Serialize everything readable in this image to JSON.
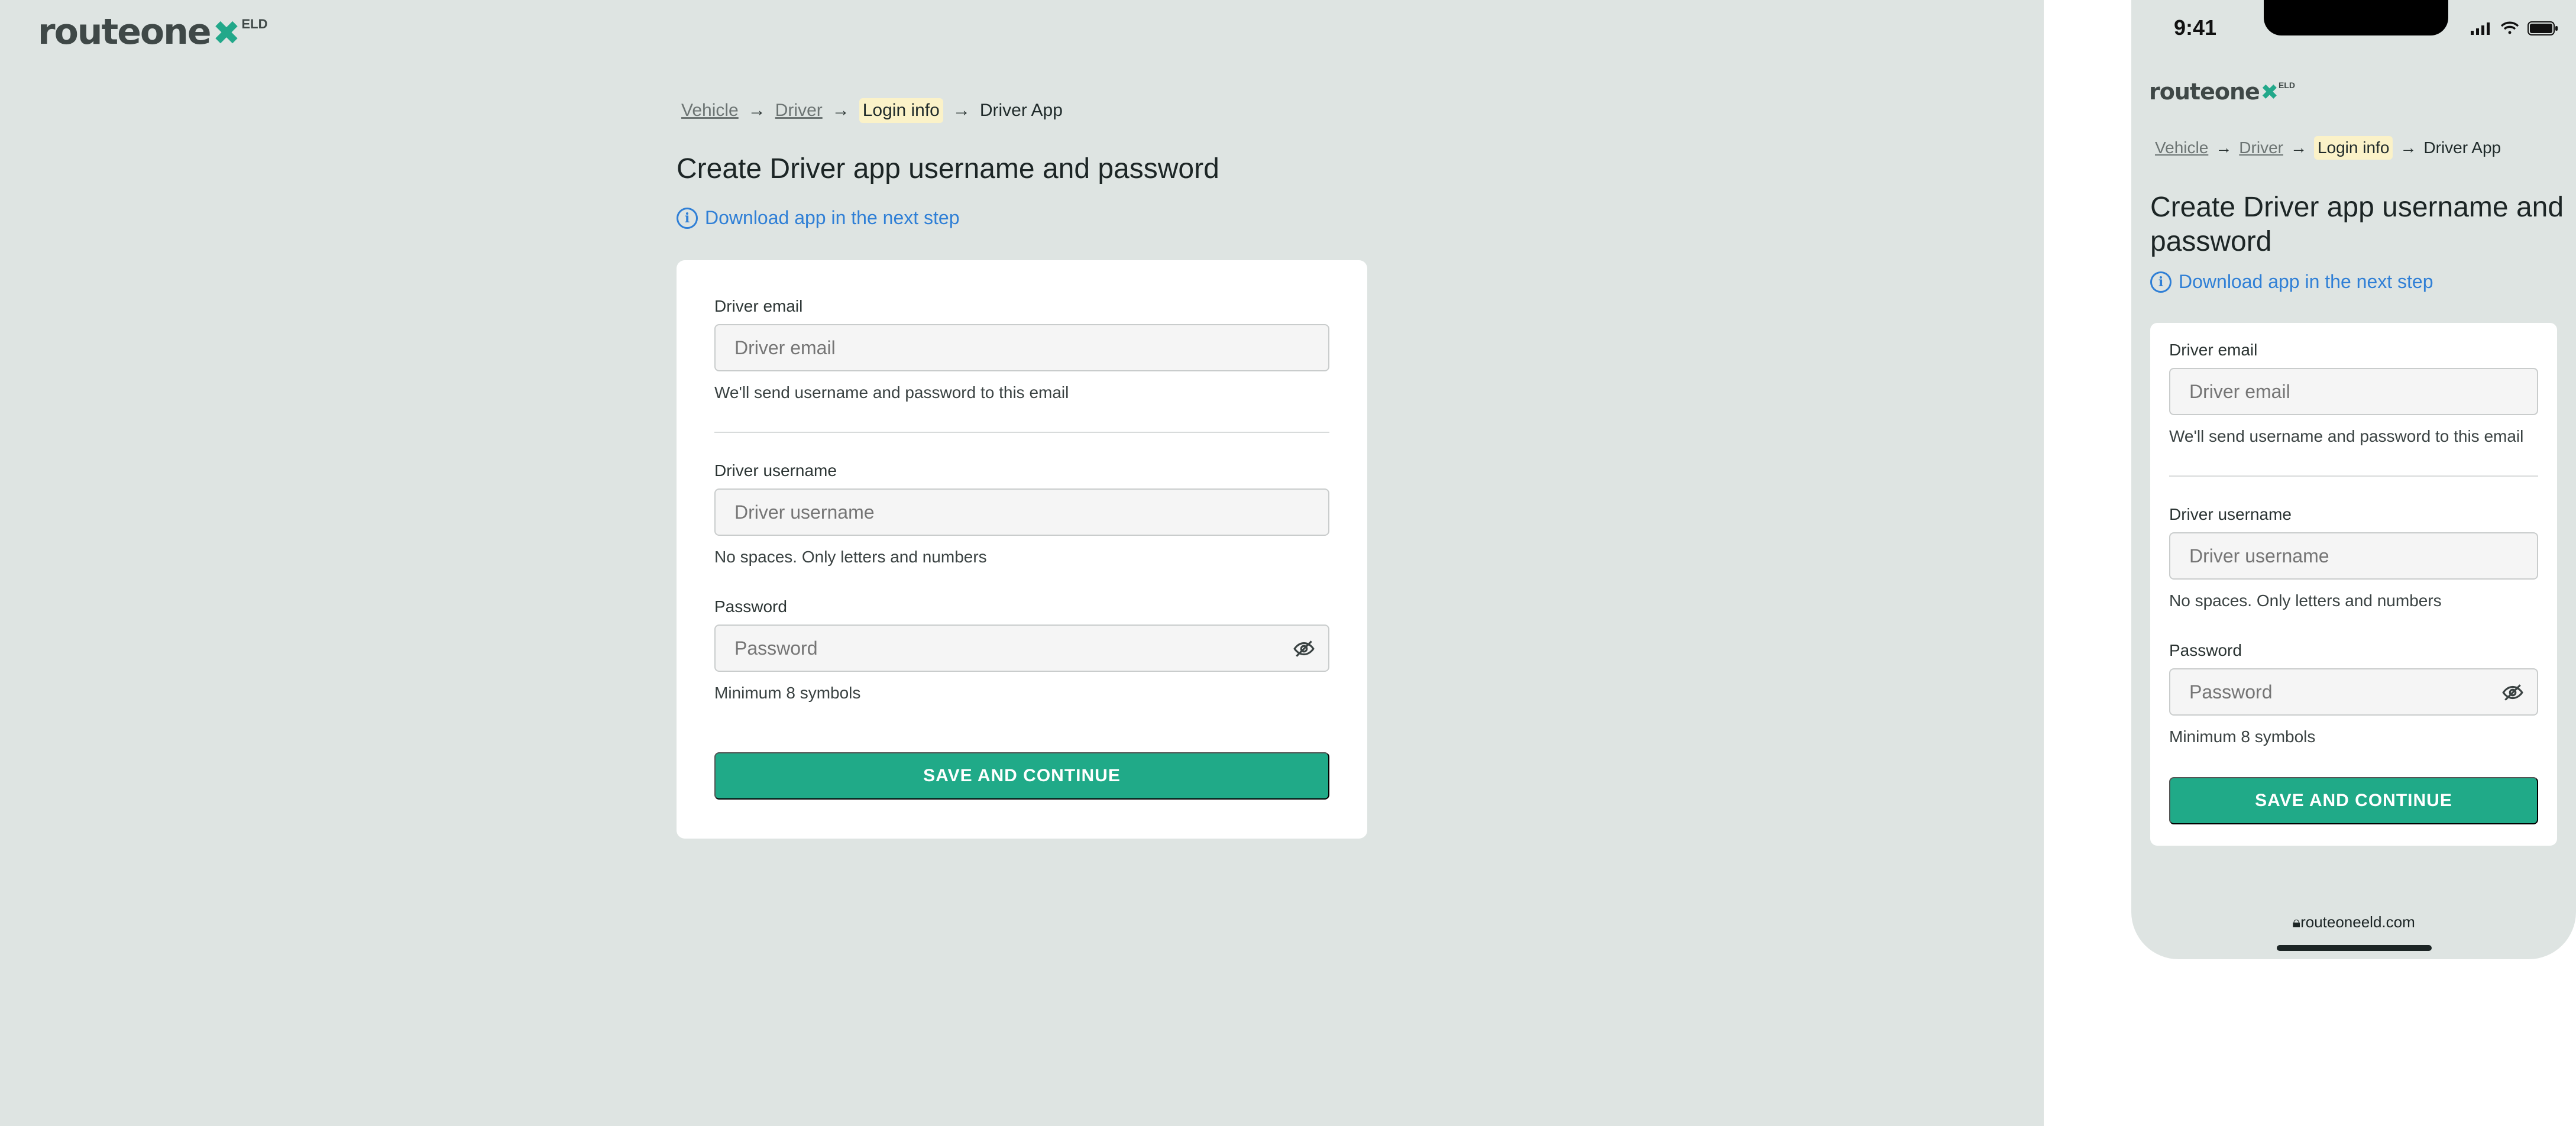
{
  "brand": {
    "word": "routeone",
    "sup": "ELD"
  },
  "breadcrumb": {
    "items": [
      {
        "label": "Vehicle"
      },
      {
        "label": "Driver"
      },
      {
        "label": "Login info"
      },
      {
        "label": "Driver App"
      }
    ],
    "arrow": "→"
  },
  "page": {
    "title": "Create Driver app username and password",
    "download_link": "Download app in the next step",
    "info_icon_glyph": "i"
  },
  "form": {
    "email": {
      "label": "Driver email",
      "placeholder": "Driver email",
      "value": "",
      "hint": "We'll send username and password to this email"
    },
    "username": {
      "label": "Driver username",
      "placeholder": "Driver username",
      "value": "",
      "hint": "No spaces. Only letters and numbers"
    },
    "password": {
      "label": "Password",
      "placeholder": "Password",
      "value": "",
      "hint": "Minimum 8 symbols"
    },
    "submit_label": "SAVE AND CONTINUE"
  },
  "mobile": {
    "status_time": "9:41",
    "url": "routeoneeld.com"
  },
  "colors": {
    "background": "#dee4e2",
    "accent": "#20aa88",
    "link": "#2f7fd6",
    "highlight": "#fbf2c8"
  },
  "icons": [
    "info-icon",
    "eye-off-icon",
    "lock-icon",
    "signal-icon",
    "wifi-icon",
    "battery-icon",
    "logo-cross-icon"
  ]
}
